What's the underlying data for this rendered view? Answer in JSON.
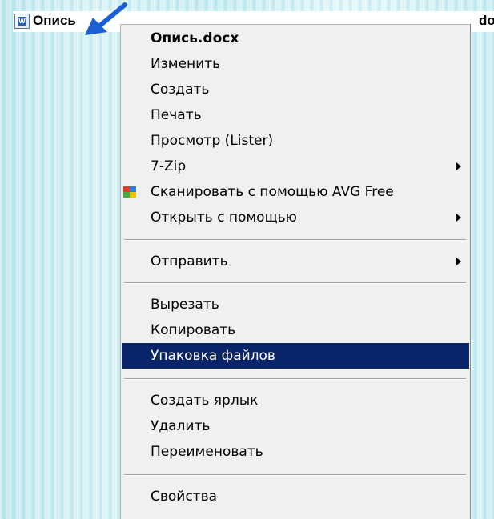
{
  "file": {
    "name": "Опись",
    "ext_visible": "docx",
    "icon": "word-document-icon"
  },
  "menu": {
    "items": [
      {
        "label": "Опись.docx",
        "bold": true
      },
      {
        "label": "Изменить",
        "accel": "И"
      },
      {
        "label": "Создать",
        "accel": "з"
      },
      {
        "label": "Печать",
        "accel": "П"
      },
      {
        "label": "Просмотр (Lister)",
        "accel": "с"
      },
      {
        "label": "7-Zip",
        "submenu": true
      },
      {
        "label": "Сканировать с помощью AVG Free",
        "accel": "A",
        "icon": "avg-icon"
      },
      {
        "label": "Открыть с помощью",
        "accel": "ю",
        "submenu": true
      },
      {
        "label": "Отправить",
        "accel": "ь",
        "submenu": true
      },
      {
        "label": "Вырезать",
        "accel": "В"
      },
      {
        "label": "Копировать",
        "accel": "К"
      },
      {
        "label": "Упаковка файлов",
        "highlighted": true
      },
      {
        "label": "Создать ярлык",
        "accel": "я"
      },
      {
        "label": "Удалить",
        "accel": "У"
      },
      {
        "label": "Переименовать",
        "accel": "м"
      },
      {
        "label": "Свойства",
        "accel": "й"
      }
    ],
    "highlight_color": "#0a246a"
  },
  "labels": {
    "open": "Опись.docx",
    "edit": "Изменить",
    "create": "Создать",
    "print": "Печать",
    "lister": "Просмотр (Lister)",
    "zip": "7-Zip",
    "avg": "Сканировать с помощью AVG Free",
    "open_with": "Открыть с помощью",
    "send_to": "Отправить",
    "cut": "Вырезать",
    "copy": "Копировать",
    "pack": "Упаковка файлов",
    "shortcut": "Создать ярлык",
    "delete": "Удалить",
    "rename": "Переименовать",
    "properties": "Свойства"
  }
}
